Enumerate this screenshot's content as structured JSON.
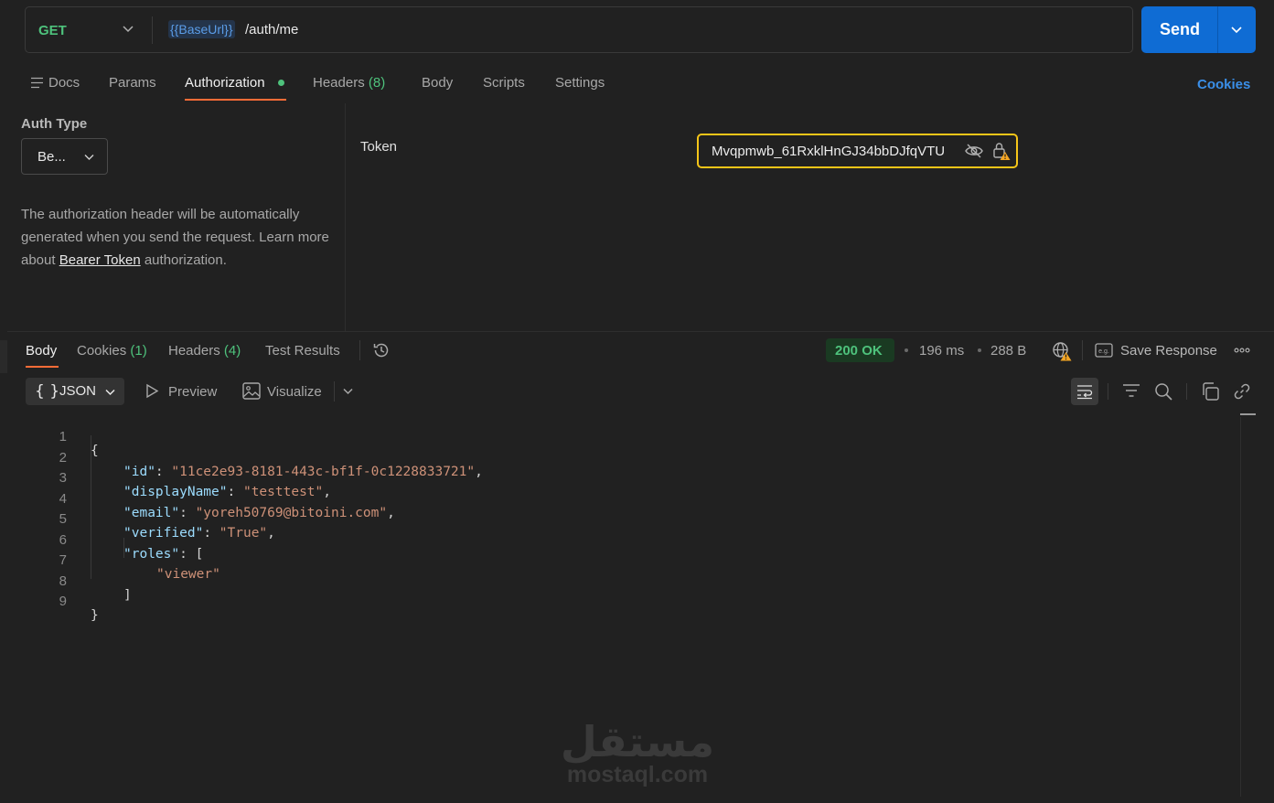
{
  "request": {
    "method": "GET",
    "url_variable": "{{BaseUrl}}",
    "url_path": "/auth/me",
    "send_label": "Send"
  },
  "request_tabs": {
    "docs": "Docs",
    "params": "Params",
    "authorization": "Authorization",
    "headers": "Headers",
    "headers_count": "(8)",
    "body": "Body",
    "scripts": "Scripts",
    "settings": "Settings",
    "cookies": "Cookies"
  },
  "auth": {
    "type_label": "Auth Type",
    "type_value": "Be...",
    "desc_before": "The authorization header will be automatically generated when you send the request. Learn more about ",
    "desc_link": "Bearer Token",
    "desc_after": " authorization.",
    "token_label": "Token",
    "token_value": "Mvqpmwb_61RxklHnGJ34bbDJfqVTU"
  },
  "response_tabs": {
    "body": "Body",
    "cookies": "Cookies",
    "cookies_count": "(1)",
    "headers": "Headers",
    "headers_count": "(4)",
    "test_results": "Test Results"
  },
  "response_meta": {
    "status": "200 OK",
    "time": "196 ms",
    "size": "288 B",
    "save_response": "Save Response"
  },
  "response_toolbar": {
    "format_braces": "{ }",
    "format": "JSON",
    "preview": "Preview",
    "visualize": "Visualize"
  },
  "code": {
    "line_numbers": [
      "1",
      "2",
      "3",
      "4",
      "5",
      "6",
      "7",
      "8",
      "9"
    ],
    "open_brace": "{",
    "close_brace": "}",
    "id_key": "\"id\"",
    "id_value": "\"11ce2e93-8181-443c-bf1f-0c1228833721\"",
    "displayName_key": "\"displayName\"",
    "displayName_value": "\"testtest\"",
    "email_key": "\"email\"",
    "email_value": "\"yoreh50769@bitoini.com\"",
    "verified_key": "\"verified\"",
    "verified_value": "\"True\"",
    "roles_key": "\"roles\"",
    "roles_open": "[",
    "roles_item": "\"viewer\"",
    "roles_close": "]"
  },
  "watermark": {
    "arabic": "مستقل",
    "latin": "mostaql.com"
  },
  "colors": {
    "accent_orange": "#ff6c37",
    "send_blue": "#0f6cd4",
    "status_green": "#4ec27c",
    "token_border": "#f5c518"
  }
}
